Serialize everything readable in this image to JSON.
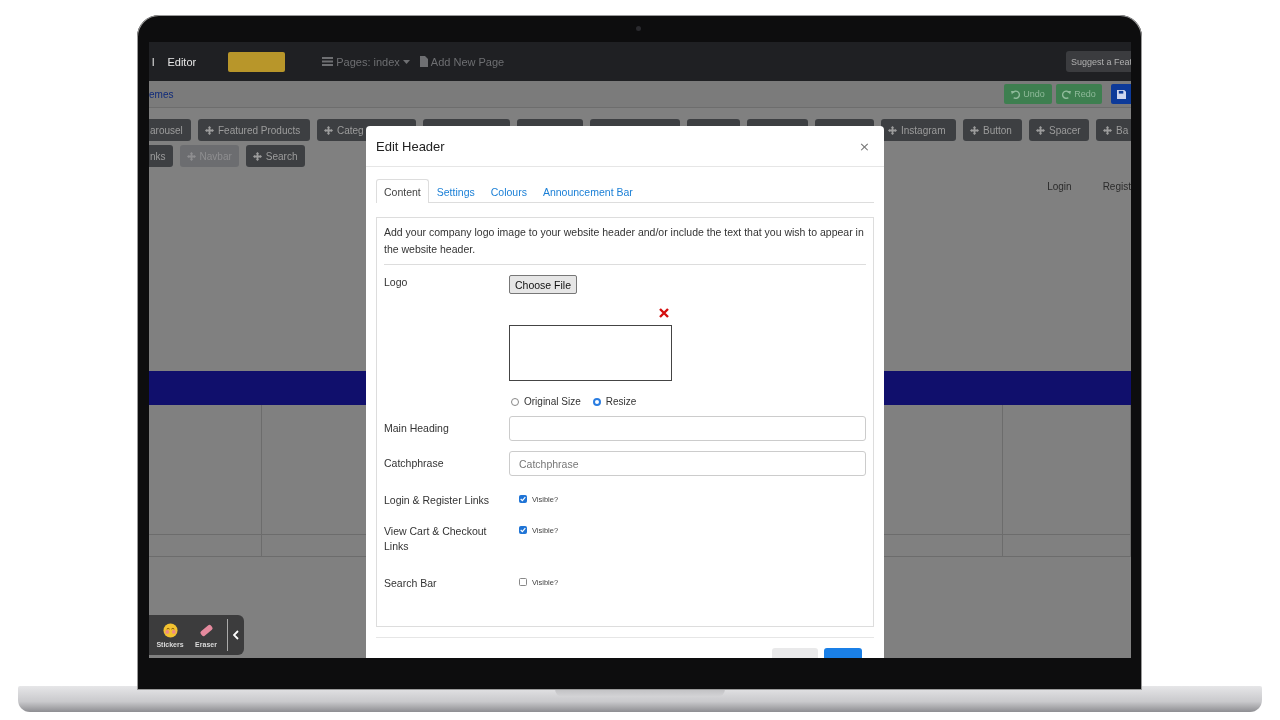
{
  "navbar": {
    "items": [
      {
        "kind": "text",
        "label": "l"
      },
      {
        "kind": "text",
        "label": "Editor"
      },
      {
        "kind": "logo"
      },
      {
        "kind": "dropdown",
        "label": "Pages: index"
      },
      {
        "kind": "page",
        "label": "Add New Page"
      }
    ],
    "suggest_button": "Suggest a Feat"
  },
  "subbar": {
    "link": "emes",
    "buttons": [
      {
        "kind": "undo",
        "label": "Undo"
      },
      {
        "kind": "redo",
        "label": "Redo"
      },
      {
        "kind": "save"
      }
    ]
  },
  "blocks": [
    {
      "label": "arousel",
      "disabled": false
    },
    {
      "label": "Featured Products",
      "disabled": false
    },
    {
      "label": "Categ",
      "disabled": false
    },
    {
      "disabled": false
    },
    {
      "disabled": false
    },
    {
      "disabled": false
    },
    {
      "disabled": false
    },
    {
      "disabled": false
    },
    {
      "disabled": false
    },
    {
      "label": "Instagram",
      "disabled": false
    },
    {
      "label": "Button",
      "disabled": false
    },
    {
      "label": "Spacer",
      "disabled": false
    },
    {
      "label": "Ba",
      "disabled": false
    },
    {
      "label": "nks",
      "disabled": false
    },
    {
      "label": "Navbar",
      "disabled": true
    },
    {
      "label": "Search",
      "disabled": false
    }
  ],
  "page": {
    "nav_links": [
      "Login",
      "Regist"
    ]
  },
  "drawing_tools": [
    {
      "kind": "stickers",
      "label": "Stickers"
    },
    {
      "kind": "eraser",
      "label": "Eraser"
    }
  ],
  "modal": {
    "title": "Edit Header",
    "close": "×",
    "tabs": [
      {
        "label": "Content",
        "selected": true
      },
      {
        "label": "Settings",
        "selected": false
      },
      {
        "label": "Colours",
        "selected": false
      },
      {
        "label": "Announcement Bar",
        "selected": false
      }
    ],
    "description": "Add your company logo image to your website header and/or include the text that you wish to appear in the website header.",
    "fields": [
      {
        "kind": "file",
        "label": "Logo",
        "button": "Choose File",
        "options": [
          {
            "label": "Original Size",
            "selected": false
          },
          {
            "label": "Resize",
            "selected": true
          }
        ]
      },
      {
        "kind": "text",
        "label": "Main Heading"
      },
      {
        "kind": "text",
        "label": "Catchphrase",
        "placeholder": "Catchphrase"
      },
      {
        "kind": "checkbox",
        "label": "Login & Register Links",
        "option": "Visible?",
        "checked": true
      },
      {
        "kind": "checkbox",
        "label": "View Cart & Checkout Links",
        "option": "Visible?",
        "checked": true
      },
      {
        "kind": "checkbox",
        "label": "Search Bar",
        "option": "Visible?",
        "checked": false
      }
    ],
    "footer_buttons": [
      {
        "kind": "secondary"
      },
      {
        "kind": "primary"
      }
    ]
  }
}
